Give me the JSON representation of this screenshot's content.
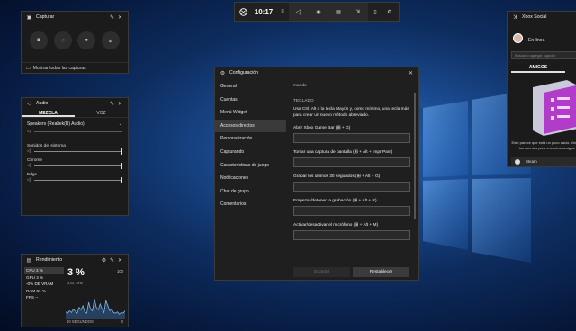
{
  "gamebar": {
    "time": "10:17",
    "icons": [
      "xbox-icon",
      "menu-icon",
      "audio-icon",
      "capture-icon",
      "performance-icon",
      "xbox-social-icon",
      "gallery-icon",
      "settings-icon"
    ]
  },
  "capture": {
    "title": "Capturar",
    "show_all": "Mostrar todas las capturas"
  },
  "audio": {
    "title": "Audio",
    "tabs": [
      "MEZCLA",
      "VOZ"
    ],
    "device": "Speakers (Realtek(R) Audio)",
    "master_level": "\u0001",
    "sources": [
      {
        "label": "Sonidos del sistema",
        "level": 1.0
      },
      {
        "label": "Chrome",
        "level": 1.0
      },
      {
        "label": "Edge",
        "level": 1.0
      }
    ]
  },
  "performance": {
    "title": "Rendimiento",
    "stats": [
      "CPU  3 %",
      "GPU  3 %",
      "-0% DE VRAM",
      "RAM  81 %",
      "FPS  --"
    ],
    "big": "3 %",
    "ghz": "3,61 GHz",
    "max": "100",
    "footer": "60 SEGUNDOS",
    "zero": "0",
    "cpu_series": [
      22,
      18,
      25,
      20,
      30,
      24,
      18,
      35,
      28,
      40,
      22,
      18,
      50,
      30,
      25,
      60,
      35,
      28,
      45,
      30,
      20,
      55,
      40,
      25,
      30,
      20,
      18,
      22,
      15,
      20,
      18,
      25
    ]
  },
  "settings": {
    "title": "Configuración",
    "nav": [
      "General",
      "Cuentas",
      "Menú Widget",
      "Accesos directos",
      "Personalización",
      "Capturando",
      "Características de juego",
      "Notificaciones",
      "Chat de grupo",
      "Comentarios"
    ],
    "active_index": 3,
    "cut_text": "mando",
    "section": "TECLADO",
    "description": "Usa Ctrl, Alt o la tecla Mayús y, como mínimo, una tecla más para crear un nuevo método abreviado.",
    "shortcuts": [
      {
        "label": "Abrir Xbox Game Bar (⊞ + G)"
      },
      {
        "label": "Tomar una captura de pantalla (⊞ + Alt + Impr Pant)"
      },
      {
        "label": "Grabar los últimos 30 segundos (⊞ + Alt + G)"
      },
      {
        "label": "Empezar/detener la grabación (⊞ + Alt + R)"
      },
      {
        "label": "Activar/desactivar el micrófono (⊞ + Alt + M)"
      }
    ],
    "save": "Guardar",
    "reset": "Restablecer"
  },
  "social": {
    "title": "Xbox Social",
    "status": "En línea",
    "search_placeholder": "Buscar o agregar jugador",
    "tab": "AMIGOS",
    "empty_text": "Esto parece que está un poco vacío. Vincula tus cuentas para encontrar amigos.",
    "steam": "Steam"
  }
}
